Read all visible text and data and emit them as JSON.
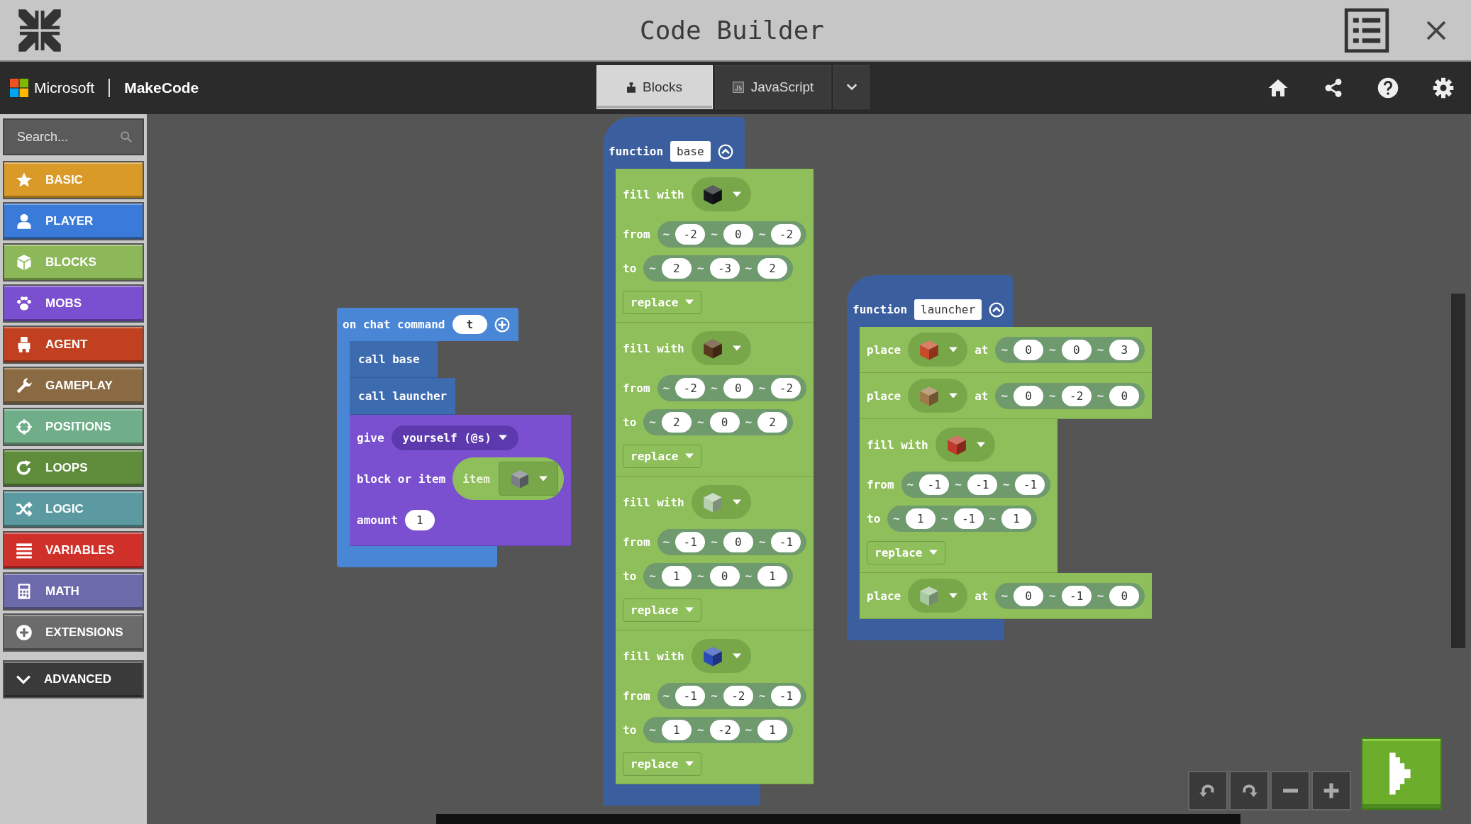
{
  "window": {
    "title": "Code Builder"
  },
  "header": {
    "brand": "Microsoft",
    "product": "MakeCode",
    "tabs": [
      {
        "label": "Blocks",
        "selected": true
      },
      {
        "label": "JavaScript",
        "selected": false
      }
    ]
  },
  "toolbox": {
    "search": {
      "placeholder": "Search..."
    },
    "categories": [
      {
        "label": "BASIC",
        "color": "#d99a28"
      },
      {
        "label": "PLAYER",
        "color": "#3a7ad8"
      },
      {
        "label": "BLOCKS",
        "color": "#8cb85a"
      },
      {
        "label": "MOBS",
        "color": "#7a4fd0"
      },
      {
        "label": "AGENT",
        "color": "#c0401f"
      },
      {
        "label": "GAMEPLAY",
        "color": "#8a6a42"
      },
      {
        "label": "POSITIONS",
        "color": "#6fae89"
      },
      {
        "label": "LOOPS",
        "color": "#5e8c3a"
      },
      {
        "label": "LOGIC",
        "color": "#5a9aa0"
      },
      {
        "label": "VARIABLES",
        "color": "#d0302a"
      },
      {
        "label": "MATH",
        "color": "#6c6aaa"
      },
      {
        "label": "EXTENSIONS",
        "color": "#6b6b6b"
      }
    ],
    "advanced": "ADVANCED"
  },
  "workspace": {
    "blocks": [
      {
        "kind": "event",
        "label": "on chat command",
        "arg": "t",
        "children": [
          {
            "kind": "call",
            "label": "call base"
          },
          {
            "kind": "call",
            "label": "call launcher"
          },
          {
            "kind": "give",
            "label": "give",
            "target": "yourself (@s)",
            "item_label": "block or item",
            "item_type": "item",
            "color": "#7a7f86",
            "amount_label": "amount",
            "amount": "1"
          }
        ]
      },
      {
        "kind": "function",
        "label": "function",
        "name": "base",
        "children": [
          {
            "kind": "fill",
            "label": "fill with",
            "color": "#15181c",
            "from_label": "from",
            "from": [
              {
                "rel": "~",
                "value": "-2"
              },
              {
                "rel": "~",
                "value": "0"
              },
              {
                "rel": "~",
                "value": "-2"
              }
            ],
            "to_label": "to",
            "to": [
              {
                "rel": "~",
                "value": "2"
              },
              {
                "rel": "~",
                "value": "-3"
              },
              {
                "rel": "~",
                "value": "2"
              }
            ],
            "mode": "replace"
          },
          {
            "kind": "fill",
            "label": "fill with",
            "color": "#5a3a1e",
            "from_label": "from",
            "from": [
              {
                "rel": "~",
                "value": "-2"
              },
              {
                "rel": "~",
                "value": "0"
              },
              {
                "rel": "~",
                "value": "-2"
              }
            ],
            "to_label": "to",
            "to": [
              {
                "rel": "~",
                "value": "2"
              },
              {
                "rel": "~",
                "value": "0"
              },
              {
                "rel": "~",
                "value": "2"
              }
            ],
            "mode": "replace"
          },
          {
            "kind": "fill",
            "label": "fill with",
            "color": "#b8d0b0",
            "from_label": "from",
            "from": [
              {
                "rel": "~",
                "value": "-1"
              },
              {
                "rel": "~",
                "value": "0"
              },
              {
                "rel": "~",
                "value": "-1"
              }
            ],
            "to_label": "to",
            "to": [
              {
                "rel": "~",
                "value": "1"
              },
              {
                "rel": "~",
                "value": "0"
              },
              {
                "rel": "~",
                "value": "1"
              }
            ],
            "mode": "replace"
          },
          {
            "kind": "fill",
            "label": "fill with",
            "color": "#2a4ab8",
            "from_label": "from",
            "from": [
              {
                "rel": "~",
                "value": "-1"
              },
              {
                "rel": "~",
                "value": "-2"
              },
              {
                "rel": "~",
                "value": "-1"
              }
            ],
            "to_label": "to",
            "to": [
              {
                "rel": "~",
                "value": "1"
              },
              {
                "rel": "~",
                "value": "-2"
              },
              {
                "rel": "~",
                "value": "1"
              }
            ],
            "mode": "replace"
          }
        ]
      },
      {
        "kind": "function",
        "label": "function",
        "name": "launcher",
        "children": [
          {
            "kind": "place",
            "label": "place",
            "color": "#c84a2a",
            "at_label": "at",
            "pos": [
              {
                "rel": "~",
                "value": "0"
              },
              {
                "rel": "~",
                "value": "0"
              },
              {
                "rel": "~",
                "value": "3"
              }
            ]
          },
          {
            "kind": "place",
            "label": "place",
            "color": "#a07a48",
            "at_label": "at",
            "pos": [
              {
                "rel": "~",
                "value": "0"
              },
              {
                "rel": "~",
                "value": "-2"
              },
              {
                "rel": "~",
                "value": "0"
              }
            ]
          },
          {
            "kind": "fill",
            "label": "fill with",
            "color": "#c0392b",
            "from_label": "from",
            "from": [
              {
                "rel": "~",
                "value": "-1"
              },
              {
                "rel": "~",
                "value": "-1"
              },
              {
                "rel": "~",
                "value": "-1"
              }
            ],
            "to_label": "to",
            "to": [
              {
                "rel": "~",
                "value": "1"
              },
              {
                "rel": "~",
                "value": "-1"
              },
              {
                "rel": "~",
                "value": "1"
              }
            ],
            "mode": "replace"
          },
          {
            "kind": "place",
            "label": "place",
            "color": "#a8c8a0",
            "at_label": "at",
            "pos": [
              {
                "rel": "~",
                "value": "0"
              },
              {
                "rel": "~",
                "value": "-1"
              },
              {
                "rel": "~",
                "value": "0"
              }
            ]
          }
        ]
      }
    ]
  }
}
